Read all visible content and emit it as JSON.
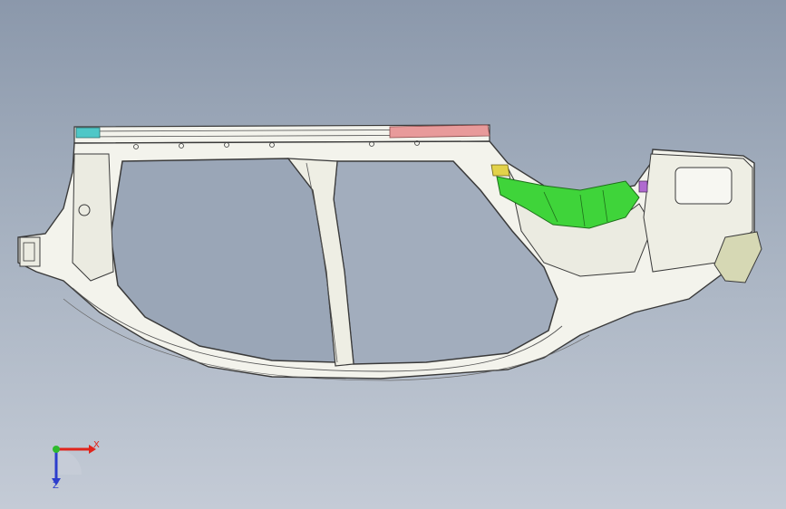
{
  "viewport": {
    "background_top": "#8b98ab",
    "background_bottom": "#c4cbd6"
  },
  "model": {
    "part_fill": "#f3f3ec",
    "edge_color": "#3a3a3a",
    "highlight_green": "#3fd43a",
    "highlight_red": "#e89a9a",
    "highlight_yellow": "#e2d24a",
    "highlight_teal": "#4fc7c7",
    "highlight_purple": "#b06ad0"
  },
  "triad": {
    "x_label": "X",
    "z_label": "Z",
    "x_color": "#e0241b",
    "y_color": "#2dbb2d",
    "z_color": "#2c3dcc"
  }
}
